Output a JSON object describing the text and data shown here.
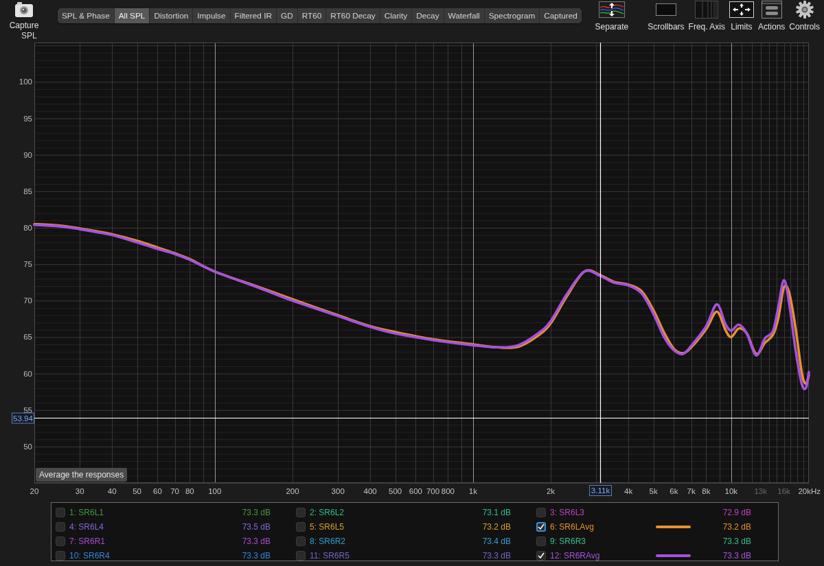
{
  "toolbar": {
    "capture": {
      "label": "Capture"
    },
    "tabs": [
      {
        "label": "SPL & Phase",
        "selected": false
      },
      {
        "label": "All SPL",
        "selected": true
      },
      {
        "label": "Distortion",
        "selected": false
      },
      {
        "label": "Impulse",
        "selected": false
      },
      {
        "label": "Filtered IR",
        "selected": false
      },
      {
        "label": "GD",
        "selected": false
      },
      {
        "label": "RT60",
        "selected": false
      },
      {
        "label": "RT60 Decay",
        "selected": false
      },
      {
        "label": "Clarity",
        "selected": false
      },
      {
        "label": "Decay",
        "selected": false
      },
      {
        "label": "Waterfall",
        "selected": false
      },
      {
        "label": "Spectrogram",
        "selected": false
      },
      {
        "label": "Captured",
        "selected": false
      }
    ],
    "tools": [
      {
        "kind": "separate",
        "label": "Separate"
      },
      {
        "kind": "scrollbars",
        "label": "Scrollbars"
      },
      {
        "kind": "freq_axis",
        "label": "Freq. Axis"
      },
      {
        "kind": "limits",
        "label": "Limits"
      },
      {
        "kind": "actions",
        "label": "Actions"
      },
      {
        "kind": "controls",
        "label": "Controls"
      }
    ]
  },
  "graph": {
    "chart_data": [
      {
        "type": "line",
        "ylabel": "SPL",
        "xlabel": "Hz",
        "log": "x",
        "grid": true,
        "xlim": [
          20,
          20000
        ],
        "ylim": [
          45,
          105.4
        ],
        "x": [
          20,
          25,
          30,
          35,
          40,
          50,
          60,
          70,
          80,
          100,
          150,
          200,
          300,
          400,
          500,
          700,
          1000,
          1250,
          1500,
          1800,
          2000,
          2300,
          2700,
          3110,
          3500,
          4000,
          4500,
          5000,
          5500,
          6000,
          6500,
          7000,
          8000,
          8800,
          9500,
          10000,
          10700,
          11500,
          12500,
          13500,
          14500,
          15200,
          16000,
          16800,
          17800,
          18800,
          19500,
          20000
        ],
        "series": [
          {
            "color": "#e8922a",
            "values": [
              80.5,
              80.3,
              79.9,
              79.5,
              79.1,
              78.2,
              77.3,
              76.5,
              75.7,
              74.0,
              71.8,
              70.2,
              68.0,
              66.5,
              65.7,
              64.7,
              64.0,
              63.6,
              63.7,
              65.3,
              66.9,
              70.5,
              74.0,
              73.5,
              72.6,
              72.2,
              71.3,
              68.7,
              65.6,
              63.4,
              62.8,
              63.6,
              66.1,
              68.5,
              66.0,
              65.0,
              66.2,
              65.5,
              62.7,
              64.2,
              65.3,
              67.5,
              71.8,
              71.0,
              66.0,
              60.0,
              58.6,
              59.8
            ]
          },
          {
            "color": "#a552e0",
            "values": [
              80.4,
              80.2,
              79.8,
              79.4,
              79.0,
              78.0,
              77.1,
              76.4,
              75.6,
              74.0,
              71.7,
              70.0,
              67.9,
              66.4,
              65.5,
              64.6,
              63.9,
              63.6,
              63.9,
              65.6,
              67.2,
              70.8,
              74.0,
              73.4,
              72.5,
              72.1,
              71.0,
              68.2,
              65.0,
              63.2,
              62.7,
              63.8,
              66.5,
              69.5,
              66.8,
              65.9,
              66.7,
              65.5,
              62.5,
              64.8,
              65.8,
              69.0,
              72.8,
              69.5,
              63.0,
              58.5,
              58.1,
              60.2
            ]
          }
        ],
        "xticks": [
          {
            "value": 20,
            "label": "20"
          },
          {
            "value": 30,
            "label": "30"
          },
          {
            "value": 40,
            "label": "40"
          },
          {
            "value": 50,
            "label": "50"
          },
          {
            "value": 60,
            "label": "60"
          },
          {
            "value": 70,
            "label": "70"
          },
          {
            "value": 80,
            "label": "80"
          },
          {
            "value": 100,
            "label": "100"
          },
          {
            "value": 200,
            "label": "200"
          },
          {
            "value": 300,
            "label": "300"
          },
          {
            "value": 400,
            "label": "400"
          },
          {
            "value": 500,
            "label": "500"
          },
          {
            "value": 600,
            "label": "600"
          },
          {
            "value": 700,
            "label": "700"
          },
          {
            "value": 800,
            "label": "800"
          },
          {
            "value": 1000,
            "label": "1k"
          },
          {
            "value": 2000,
            "label": "2k"
          },
          {
            "value": 4000,
            "label": "4k"
          },
          {
            "value": 5000,
            "label": "5k"
          },
          {
            "value": 6000,
            "label": "6k"
          },
          {
            "value": 7000,
            "label": "7k"
          },
          {
            "value": 8000,
            "label": "8k"
          },
          {
            "value": 10000,
            "label": "10k"
          },
          {
            "value": 13000,
            "label": "13k"
          },
          {
            "value": 16000,
            "label": "16k"
          },
          {
            "value": 20000,
            "label": "20k"
          }
        ],
        "yticks": [
          50,
          55,
          60,
          65,
          70,
          75,
          80,
          85,
          90,
          95,
          100
        ],
        "ref_lines": [
          {
            "axis": "y",
            "value": 53.94,
            "label": "53.94",
            "color": "#ffffff"
          },
          {
            "axis": "x",
            "value": 3110,
            "label": "3.11k",
            "color": "#ffffff"
          }
        ]
      }
    ],
    "overlay_button": "Average the responses"
  },
  "legend": {
    "items": [
      {
        "name": "1: SR6L1",
        "value": "73.3 dB",
        "color": "#3f9b3f",
        "checked": false,
        "focused": false
      },
      {
        "name": "2: SR6L2",
        "value": "73.1 dB",
        "color": "#2fbf8a",
        "checked": false,
        "focused": false
      },
      {
        "name": "3: SR6L3",
        "value": "72.9 dB",
        "color": "#c23fc2",
        "checked": false,
        "focused": false
      },
      {
        "name": "4: SR6L4",
        "value": "73.5 dB",
        "color": "#8468d8",
        "checked": false,
        "focused": false
      },
      {
        "name": "5: SR6L5",
        "value": "73.2 dB",
        "color": "#d4a22a",
        "checked": false,
        "focused": false
      },
      {
        "name": "6: SR6LAvg",
        "value": "73.2 dB",
        "color": "#e8922a",
        "checked": true,
        "focused": true
      },
      {
        "name": "7: SR6R1",
        "value": "73.3 dB",
        "color": "#b04ad0",
        "checked": false,
        "focused": false
      },
      {
        "name": "8: SR6R2",
        "value": "73.4 dB",
        "color": "#2f9fcf",
        "checked": false,
        "focused": false
      },
      {
        "name": "9: SR6R3",
        "value": "73.3 dB",
        "color": "#32c08c",
        "checked": false,
        "focused": false
      },
      {
        "name": "10: SR6R4",
        "value": "73.3 dB",
        "color": "#2f86e0",
        "checked": false,
        "focused": false
      },
      {
        "name": "11: SR6R5",
        "value": "73.3 dB",
        "color": "#7064c8",
        "checked": false,
        "focused": false
      },
      {
        "name": "12: SR6RAvg",
        "value": "73.3 dB",
        "color": "#a552e0",
        "checked": true,
        "focused": false
      }
    ]
  }
}
